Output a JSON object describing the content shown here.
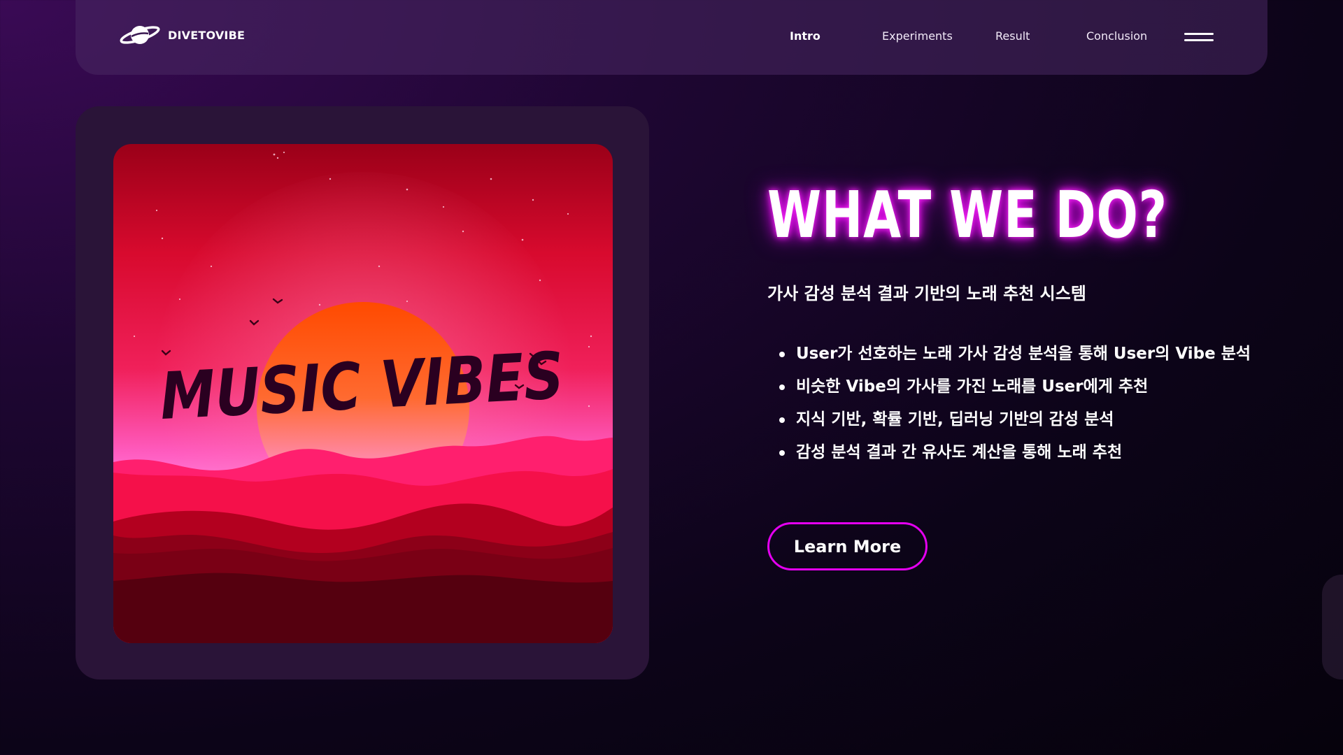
{
  "brand": {
    "name": "DIVETOVIBE",
    "logo_icon": "planet-icon"
  },
  "nav": {
    "items": [
      {
        "label": "Intro",
        "active": true
      },
      {
        "label": "Experiments",
        "active": false
      },
      {
        "label": "Result",
        "active": false
      },
      {
        "label": "Conclusion",
        "active": false
      }
    ],
    "menu_icon": "hamburger-menu-icon"
  },
  "artwork": {
    "title": "MUSIC VIBES"
  },
  "hero": {
    "headline": "WHAT WE DO?",
    "subtitle": "가사 감성 분석 결과 기반의 노래 추천 시스템",
    "features": [
      "User가 선호하는 노래 가사 감성 분석을 통해 User의 Vibe 분석",
      "비슷한 Vibe의 가사를 가진 노래를 User에게 추천",
      "지식 기반, 확률 기반, 딥러닝 기반의 감성 분석",
      "감성 분석 결과 간 유사도 계산을 통해 노래 추천"
    ],
    "cta_label": "Learn More"
  },
  "colors": {
    "accent": "#e400f0",
    "glow": "#ff2bff",
    "background": "#1e0632",
    "card": "#2a1438"
  }
}
